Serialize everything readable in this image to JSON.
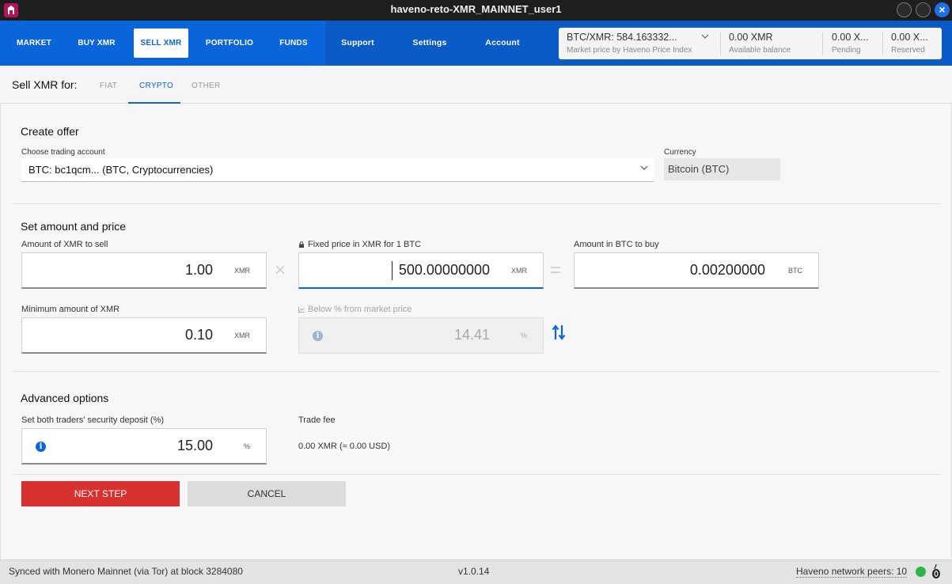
{
  "window": {
    "title": "haveno-reto-XMR_MAINNET_user1"
  },
  "nav": {
    "market": "MARKET",
    "buy_xmr": "BUY XMR",
    "sell_xmr": "SELL XMR",
    "portfolio": "PORTFOLIO",
    "funds": "FUNDS",
    "support": "Support",
    "settings": "Settings",
    "account": "Account"
  },
  "balances": {
    "price_value": "BTC/XMR: 584.163332...",
    "price_label": "Market price by Haveno Price Index",
    "available_value": "0.00 XMR",
    "available_label": "Available balance",
    "pending_value": "0.00 X...",
    "pending_label": "Pending",
    "reserved_value": "0.00 X...",
    "reserved_label": "Reserved"
  },
  "subtabs": {
    "sell_for": "Sell XMR for:",
    "fiat": "FIAT",
    "crypto": "CRYPTO",
    "other": "OTHER",
    "active": "CRYPTO"
  },
  "create_offer": {
    "title": "Create offer",
    "account_label": "Choose trading account",
    "account_value": "BTC: bc1qcm... (BTC, Cryptocurrencies)",
    "currency_label": "Currency",
    "currency_value": "Bitcoin (BTC)"
  },
  "amount_price": {
    "title": "Set amount and price",
    "amount_label": "Amount of XMR to sell",
    "amount_value": "1.00",
    "amount_unit": "XMR",
    "price_label": "Fixed price in XMR for 1 BTC",
    "price_value": "500.00000000",
    "price_unit": "XMR",
    "buy_label": "Amount in BTC to buy",
    "buy_value": "0.00200000",
    "buy_unit": "BTC",
    "min_label": "Minimum amount of XMR",
    "min_value": "0.10",
    "min_unit": "XMR",
    "below_label": "Below % from market price",
    "below_value": "14.41",
    "below_unit": "%",
    "times_sign": "×",
    "equals_sign": "="
  },
  "advanced": {
    "title": "Advanced options",
    "deposit_label": "Set both traders' security deposit (%)",
    "deposit_value": "15.00",
    "deposit_unit": "%",
    "fee_label": "Trade fee",
    "fee_value": "0.00 XMR (≈ 0.00 USD)"
  },
  "actions": {
    "next": "NEXT STEP",
    "cancel": "CANCEL"
  },
  "status": {
    "sync": "Synced with Monero Mainnet (via Tor) at block 3284080",
    "version": "v1.0.14",
    "peers": "Haveno network peers: 10"
  },
  "colors": {
    "brand": "#0b65da",
    "next_button": "#d7322f",
    "status_ok": "#2db54a"
  }
}
